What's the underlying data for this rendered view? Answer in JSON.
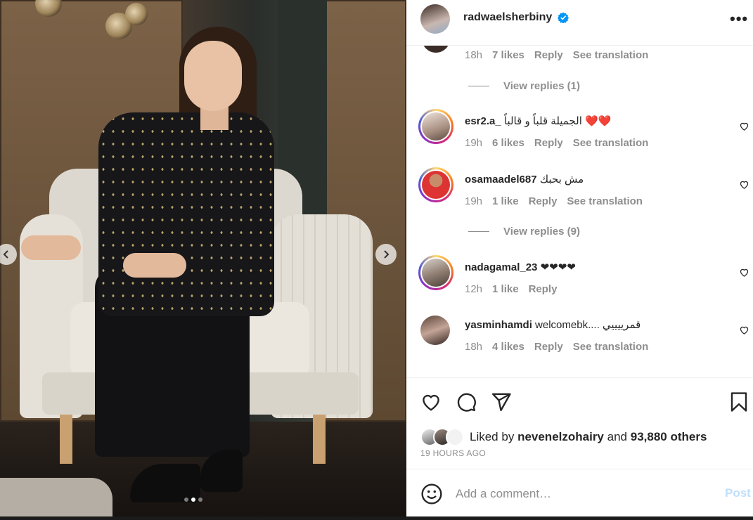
{
  "post": {
    "author": "radwaelsherbiny",
    "verified": true,
    "media": {
      "alt": "Post photo",
      "carousel_index": 2,
      "carousel_count": 3
    }
  },
  "comments": [
    {
      "id": "partial",
      "username": "",
      "text": "",
      "time": "18h",
      "likes": "7 likes",
      "reply": "Reply",
      "translate": "See translation"
    },
    {
      "id": "c1",
      "username": "esr2.a_",
      "text": "الجميلة قلباً و قالباً ❤️❤️",
      "time": "19h",
      "likes": "6 likes",
      "reply": "Reply",
      "translate": "See translation"
    },
    {
      "id": "c2",
      "username": "osamaadel687",
      "text": "مش بحبك",
      "time": "19h",
      "likes": "1 like",
      "reply": "Reply",
      "translate": "See translation"
    },
    {
      "id": "c3",
      "username": "nadagamal_23",
      "text": "❤❤❤❤",
      "time": "12h",
      "likes": "1 like",
      "reply": "Reply",
      "translate": ""
    },
    {
      "id": "c4",
      "username": "yasminhamdi",
      "text": "welcomebk.... قمرييييي",
      "time": "18h",
      "likes": "4 likes",
      "reply": "Reply",
      "translate": "See translation"
    }
  ],
  "view_replies": [
    {
      "label": "View replies (1)"
    },
    {
      "label": "View replies (9)"
    }
  ],
  "likes": {
    "prefix": "Liked by",
    "user": "nevenelzohairy",
    "and": "and",
    "others": "93,880 others"
  },
  "time_ago": "19 HOURS AGO",
  "add_comment": {
    "placeholder": "Add a comment…",
    "post_label": "Post"
  },
  "colors": {
    "accent": "#0095f6",
    "post_disabled": "#c0dffd",
    "secondary_text": "#8e8e8e"
  },
  "icons": [
    "verified-badge-icon",
    "more-options-icon",
    "heart-icon",
    "comment-icon",
    "share-icon",
    "bookmark-icon",
    "emoji-icon",
    "chevron-left-icon",
    "chevron-right-icon"
  ]
}
